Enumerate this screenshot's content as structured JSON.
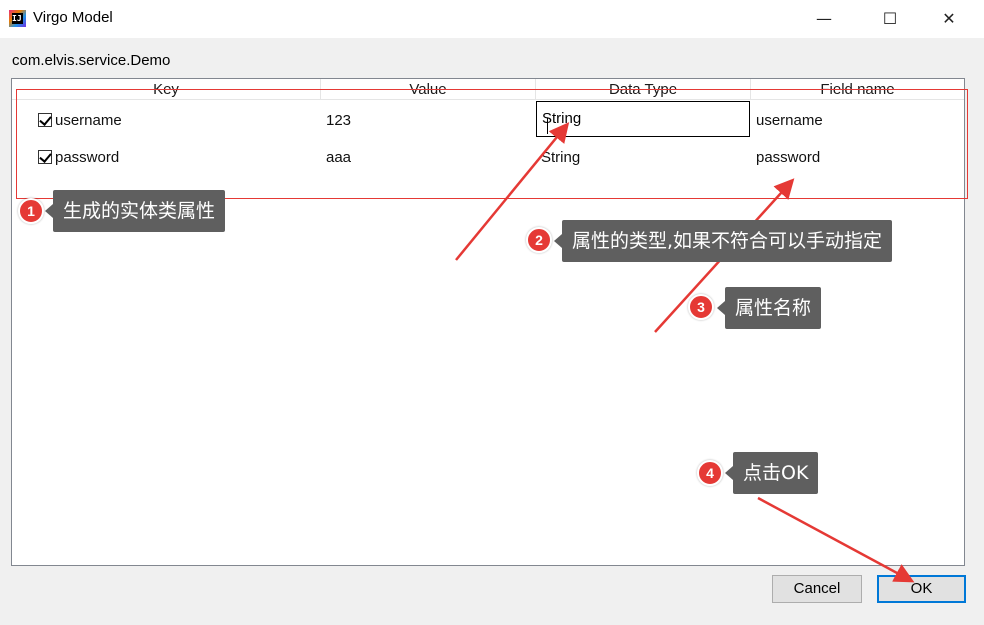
{
  "window": {
    "title": "Virgo Model",
    "icon_text": "IJ",
    "controls": {
      "minimize": "—",
      "maximize": "☐",
      "close": "✕"
    }
  },
  "package_path": "com.elvis.service.Demo",
  "table": {
    "headers": [
      "Key",
      "Value",
      "Data Type",
      "Field name"
    ],
    "rows": [
      {
        "checked": true,
        "key": "username",
        "value": "123",
        "data_type": "String",
        "field_name": "username"
      },
      {
        "checked": true,
        "key": "password",
        "value": "aaa",
        "data_type": "String",
        "field_name": "password"
      }
    ]
  },
  "buttons": {
    "cancel": "Cancel",
    "ok": "OK"
  },
  "annotations": [
    {
      "number": "1",
      "text": "生成的实体类属性"
    },
    {
      "number": "2",
      "text": "属性的类型,如果不符合可以手动指定"
    },
    {
      "number": "3",
      "text": "属性名称"
    },
    {
      "number": "4",
      "text": "点击OK"
    }
  ],
  "colors": {
    "annotation_red": "#e53935",
    "tooltip_bg": "#5f5f5f",
    "ok_border": "#0078d7"
  }
}
